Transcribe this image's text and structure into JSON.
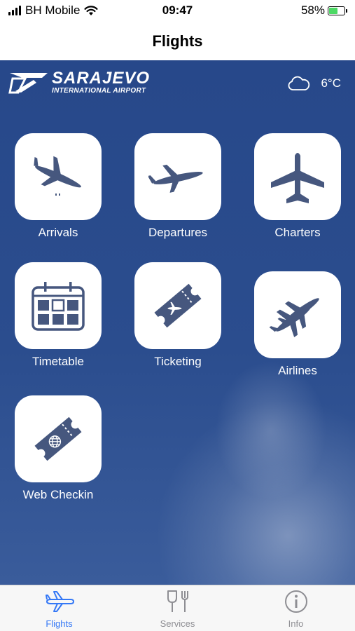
{
  "status_bar": {
    "carrier": "BH Mobile",
    "time": "09:47",
    "battery": "58%",
    "battery_level": 0.58
  },
  "nav": {
    "title": "Flights"
  },
  "brand": {
    "name": "SARAJEVO",
    "subtitle": "INTERNATIONAL AIRPORT"
  },
  "weather": {
    "temperature": "6°C",
    "icon": "cloud-icon"
  },
  "tiles": [
    {
      "label": "Arrivals",
      "icon": "arrivals-plane-icon"
    },
    {
      "label": "Departures",
      "icon": "departures-plane-icon"
    },
    {
      "label": "Charters",
      "icon": "plane-top-view-icon"
    },
    {
      "label": "Timetable",
      "icon": "calendar-icon"
    },
    {
      "label": "Ticketing",
      "icon": "ticket-icon"
    },
    {
      "label": "Airlines",
      "icon": "airlines-planes-icon"
    },
    {
      "label": "Web Checkin",
      "icon": "web-ticket-icon"
    }
  ],
  "tab_bar": {
    "items": [
      {
        "label": "Flights",
        "icon": "plane-icon",
        "active": true
      },
      {
        "label": "Services",
        "icon": "cutlery-icon",
        "active": false
      },
      {
        "label": "Info",
        "icon": "info-icon",
        "active": false
      }
    ]
  },
  "colors": {
    "background": "#2b4d8e",
    "icon": "#46577e",
    "active_tab": "#3478f6",
    "inactive_tab": "#8e8e93"
  }
}
